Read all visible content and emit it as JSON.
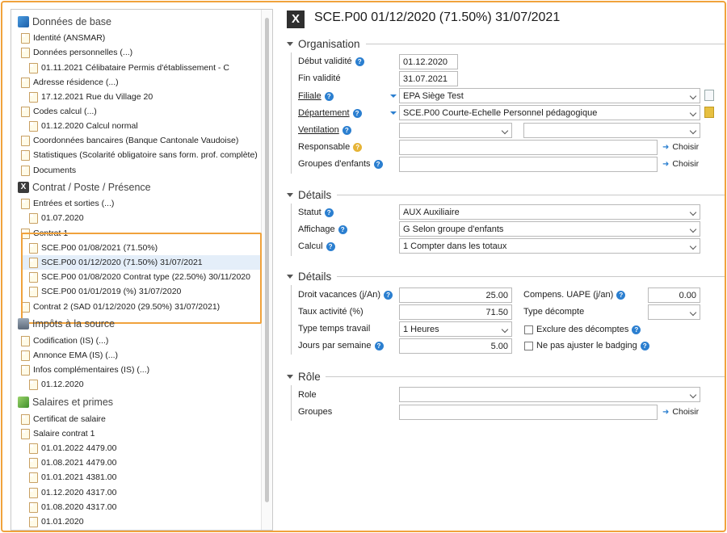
{
  "tree": {
    "sections": [
      {
        "title": "Données de base",
        "icon": "info-book-icon"
      },
      {
        "title": "Contrat / Poste / Présence",
        "icon": "contract-x-icon"
      },
      {
        "title": "Impôts à la source",
        "icon": "tax-document-icon"
      },
      {
        "title": "Salaires et primes",
        "icon": "money-icon"
      }
    ],
    "items": [
      "Identité (ANSMAR)",
      "Données personnelles (...)",
      "01.11.2021 Célibataire Permis d'établissement - C",
      "Adresse résidence (...)",
      "17.12.2021 Rue du Village 20",
      "Codes calcul (...)",
      "01.12.2020 Calcul normal",
      "Coordonnées bancaires (Banque Cantonale Vaudoise)",
      "Statistiques (Scolarité obligatoire sans form. prof. complète)",
      "Documents",
      "Entrées et sorties (...)",
      "01.07.2020",
      "Contrat 1",
      "SCE.P00 01/08/2021 (71.50%)",
      "SCE.P00 01/12/2020 (71.50%) 31/07/2021",
      "SCE.P00 01/08/2020 Contrat type (22.50%) 30/11/2020",
      "SCE.P00 01/01/2019 (%) 31/07/2020",
      "Contrat 2 (SAD 01/12/2020 (29.50%) 31/07/2021)",
      "Codification (IS) (...)",
      "Annonce EMA (IS) (...)",
      "Infos complémentaires (IS) (...)",
      "01.12.2020",
      "Certificat de salaire",
      "Salaire contrat 1",
      "01.01.2022 4479.00",
      "01.08.2021 4479.00",
      "01.01.2021 4381.00",
      "01.12.2020 4317.00",
      "01.08.2020 4317.00",
      "01.01.2020"
    ]
  },
  "header": {
    "title": "SCE.P00 01/12/2020 (71.50%) 31/07/2021"
  },
  "organisation": {
    "title": "Organisation",
    "debut_label": "Début validité",
    "debut_value": "01.12.2020",
    "fin_label": "Fin validité",
    "fin_value": "31.07.2021",
    "filiale_label": "Filiale",
    "filiale_value": "EPA Siège Test",
    "departement_label": "Département",
    "departement_value": "SCE.P00 Courte-Echelle Personnel pédagogique",
    "ventilation_label": "Ventilation",
    "ventilation_value1": "",
    "ventilation_value2": "",
    "responsable_label": "Responsable",
    "responsable_value": "",
    "groupes_label": "Groupes d'enfants",
    "groupes_value": "",
    "choose_label": "Choisir"
  },
  "details1": {
    "title": "Détails",
    "statut_label": "Statut",
    "statut_value": "AUX Auxiliaire",
    "affichage_label": "Affichage",
    "affichage_value": "G Selon groupe d'enfants",
    "calcul_label": "Calcul",
    "calcul_value": "1 Compter dans les totaux"
  },
  "details2": {
    "title": "Détails",
    "droit_label": "Droit vacances (j/An)",
    "droit_value": "25.00",
    "taux_label": "Taux activité (%)",
    "taux_value": "71.50",
    "type_temps_label": "Type temps travail",
    "type_temps_value": "1 Heures",
    "jours_label": "Jours par semaine",
    "jours_value": "5.00",
    "compens_label": "Compens. UAPE (j/an)",
    "compens_value": "0.00",
    "type_decompte_label": "Type décompte",
    "type_decompte_value": "",
    "exclure_label": "Exclure des décomptes",
    "ajuster_label": "Ne pas ajuster le badging"
  },
  "role": {
    "title": "Rôle",
    "role_label": "Role",
    "role_value": "",
    "groupes_label": "Groupes",
    "groupes_value": "",
    "choose_label": "Choisir"
  },
  "colors": {
    "accent": "#f0a23c",
    "help": "#2b7fd0",
    "selection": "#e4eef9"
  }
}
